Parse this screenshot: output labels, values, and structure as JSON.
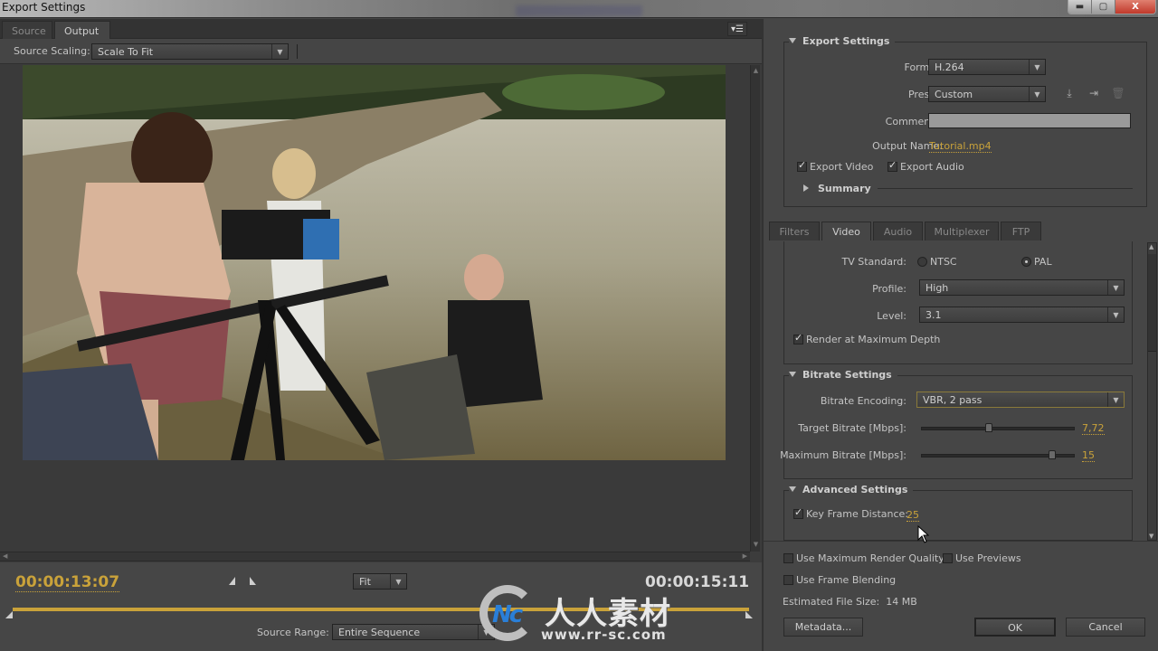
{
  "window": {
    "title": "Export Settings",
    "controls": [
      "minimize",
      "restore",
      "close"
    ]
  },
  "left_panel": {
    "tabs": [
      {
        "label": "Source",
        "active": false
      },
      {
        "label": "Output",
        "active": true
      }
    ],
    "panel_menu_icon": "panel-menu-icon",
    "source_scaling": {
      "label": "Source Scaling:",
      "value": "Scale To Fit"
    },
    "preview": {
      "description": "Video frame: film crew with camera rig at riverbank, man in suit in the water"
    },
    "timeline": {
      "current_timecode": "00:00:13:07",
      "duration_timecode": "00:00:15:11",
      "zoom": {
        "value": "Fit"
      },
      "source_range": {
        "label": "Source Range:",
        "value": "Entire Sequence"
      },
      "accent_color": "#c9a23a"
    },
    "watermark": {
      "chinese_text": "人人素材",
      "url": "www.rr-sc.com"
    }
  },
  "export_settings": {
    "section_title": "Export Settings",
    "format": {
      "label": "Format:",
      "value": "H.264"
    },
    "preset": {
      "label": "Preset:",
      "value": "Custom",
      "icons": [
        "save-preset-icon",
        "import-preset-icon",
        "delete-preset-icon"
      ]
    },
    "comments": {
      "label": "Comments:",
      "value": ""
    },
    "output_name": {
      "label": "Output Name:",
      "value": "Tutorial.mp4"
    },
    "export_video": {
      "label": "Export Video",
      "checked": true
    },
    "export_audio": {
      "label": "Export Audio",
      "checked": true
    },
    "summary": {
      "label": "Summary",
      "expanded": false
    }
  },
  "settings_tabs": [
    {
      "label": "Filters",
      "active": false
    },
    {
      "label": "Video",
      "active": true
    },
    {
      "label": "Audio",
      "active": false
    },
    {
      "label": "Multiplexer",
      "active": false
    },
    {
      "label": "FTP",
      "active": false
    }
  ],
  "video": {
    "tv_standard": {
      "label": "TV Standard:",
      "options": [
        "NTSC",
        "PAL"
      ],
      "selected": "PAL"
    },
    "profile": {
      "label": "Profile:",
      "value": "High"
    },
    "level": {
      "label": "Level:",
      "value": "3.1"
    },
    "render_max_depth": {
      "label": "Render at Maximum Depth",
      "checked": true
    }
  },
  "bitrate": {
    "section_title": "Bitrate Settings",
    "encoding": {
      "label": "Bitrate Encoding:",
      "value": "VBR, 2 pass"
    },
    "target": {
      "label": "Target Bitrate [Mbps]:",
      "value": "7,72",
      "slider_fraction": 0.44
    },
    "maximum": {
      "label": "Maximum Bitrate [Mbps]:",
      "value": "15",
      "slider_fraction": 0.86
    }
  },
  "advanced": {
    "section_title": "Advanced Settings",
    "key_frame_distance": {
      "label": "Key Frame Distance:",
      "value": "25",
      "checked": true
    }
  },
  "footer": {
    "use_max_render_quality": {
      "label": "Use Maximum Render Quality",
      "checked": false
    },
    "use_previews": {
      "label": "Use Previews",
      "checked": false
    },
    "use_frame_blending": {
      "label": "Use Frame Blending",
      "checked": false
    },
    "estimated_file_size": {
      "label": "Estimated File Size:",
      "value": "14 MB"
    },
    "metadata_button": "Metadata...",
    "ok_button": "OK",
    "cancel_button": "Cancel"
  }
}
